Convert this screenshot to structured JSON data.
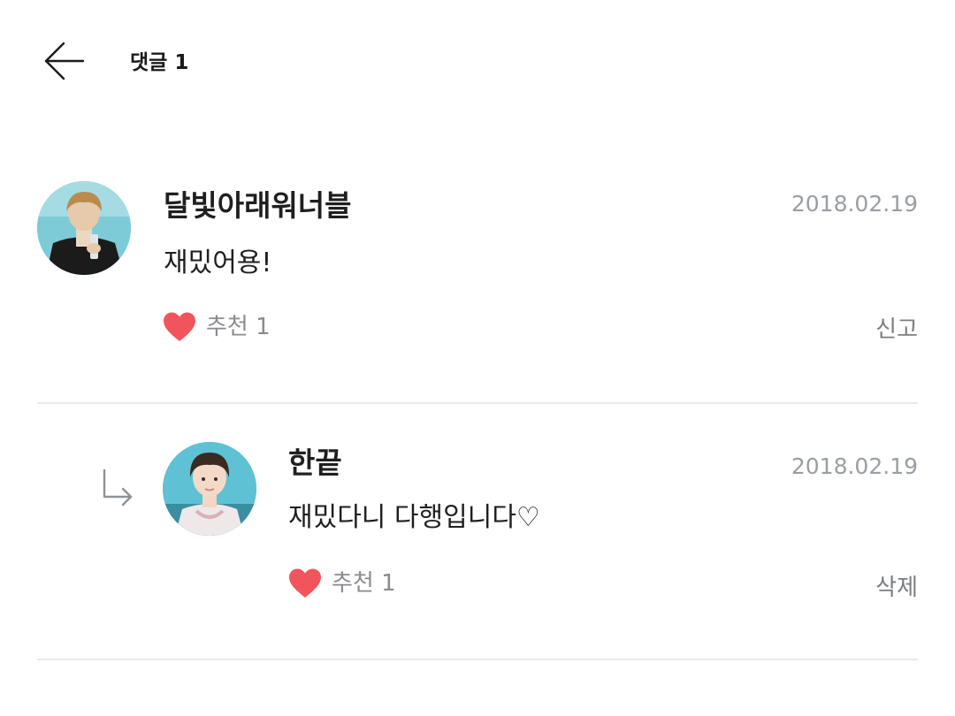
{
  "header": {
    "title": "댓글 1",
    "back_icon": "arrow-left-icon"
  },
  "comments": [
    {
      "username": "달빛아래워너블",
      "date": "2018.02.19",
      "text": "재밌어용!",
      "like_label": "추천 1",
      "action_label": "신고",
      "avatar_icon": "user-avatar"
    }
  ],
  "replies": [
    {
      "username": "한끝",
      "date": "2018.02.19",
      "text": "재밌다니 다행입니다♡",
      "like_label": "추천 1",
      "action_label": "삭제",
      "reply_icon": "reply-arrow-icon",
      "avatar_icon": "user-avatar"
    }
  ],
  "colors": {
    "heart": "#f2545b",
    "date": "#9a9ea3",
    "divider": "#e9eaec",
    "muted_text": "#888b8f"
  }
}
